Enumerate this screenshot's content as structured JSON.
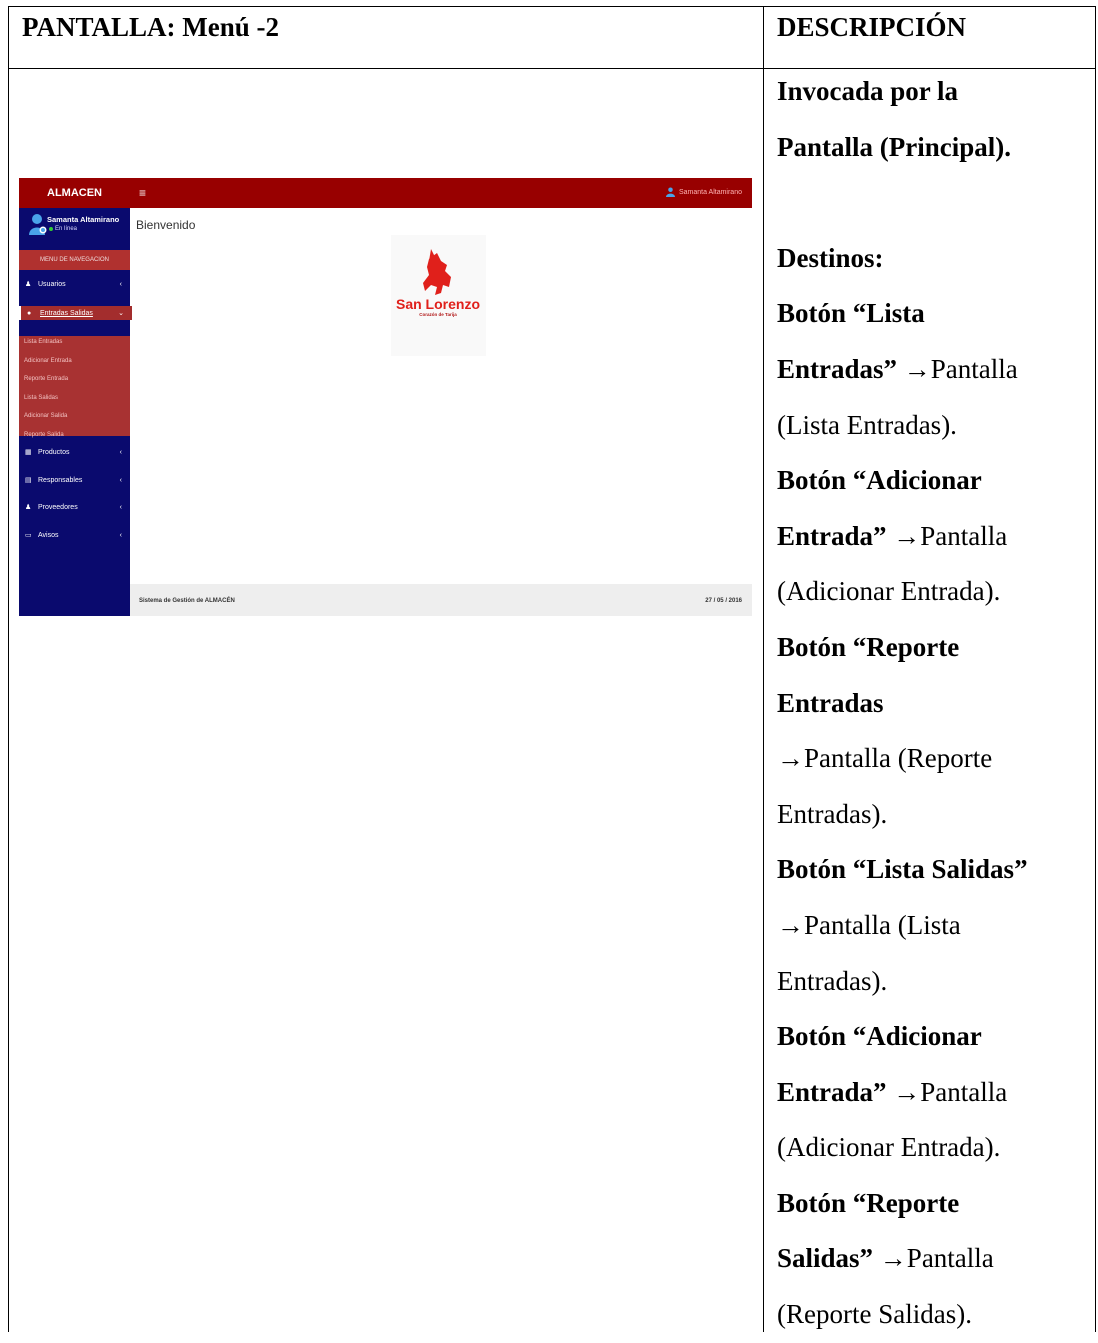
{
  "table": {
    "left_header": "PANTALLA: Menú -2",
    "right_header": "DESCRIPCIÓN"
  },
  "description": {
    "lines": [
      {
        "text": "Invocada por la",
        "bold": true
      },
      {
        "text": "Pantalla (Principal).",
        "bold": true
      },
      {
        "text": "",
        "bold": false
      },
      {
        "text": "Destinos:",
        "bold": true
      },
      {
        "parts": [
          {
            "text": "Botón “Lista",
            "bold": true
          }
        ]
      },
      {
        "parts": [
          {
            "text": "Entradas” ",
            "bold": true
          },
          {
            "text": "→Pantalla",
            "bold": false
          }
        ]
      },
      {
        "parts": [
          {
            "text": "(Lista Entradas).",
            "bold": false
          }
        ]
      },
      {
        "parts": [
          {
            "text": "Botón “Adicionar",
            "bold": true
          }
        ]
      },
      {
        "parts": [
          {
            "text": "Entrada” ",
            "bold": true
          },
          {
            "text": "→Pantalla",
            "bold": false
          }
        ]
      },
      {
        "parts": [
          {
            "text": "(Adicionar Entrada).",
            "bold": false
          }
        ]
      },
      {
        "parts": [
          {
            "text": "Botón “Reporte",
            "bold": true
          }
        ]
      },
      {
        "parts": [
          {
            "text": "Entradas",
            "bold": true
          }
        ]
      },
      {
        "parts": [
          {
            "text": "→Pantalla (Reporte",
            "bold": false
          }
        ]
      },
      {
        "parts": [
          {
            "text": "Entradas).",
            "bold": false
          }
        ]
      },
      {
        "parts": [
          {
            "text": "Botón “Lista Salidas”",
            "bold": true
          }
        ]
      },
      {
        "parts": [
          {
            "text": "→Pantalla (Lista",
            "bold": false
          }
        ]
      },
      {
        "parts": [
          {
            "text": "Entradas).",
            "bold": false
          }
        ]
      },
      {
        "parts": [
          {
            "text": "Botón “Adicionar",
            "bold": true
          }
        ]
      },
      {
        "parts": [
          {
            "text": "Entrada” ",
            "bold": true
          },
          {
            "text": "→Pantalla",
            "bold": false
          }
        ]
      },
      {
        "parts": [
          {
            "text": "(Adicionar Entrada).",
            "bold": false
          }
        ]
      },
      {
        "parts": [
          {
            "text": "Botón “Reporte",
            "bold": true
          }
        ]
      },
      {
        "parts": [
          {
            "text": "Salidas” ",
            "bold": true
          },
          {
            "text": "→Pantalla",
            "bold": false
          }
        ]
      },
      {
        "parts": [
          {
            "text": "(Reporte Salidas).",
            "bold": false
          }
        ]
      }
    ]
  },
  "app": {
    "brand": "ALMACEN",
    "menu_icon": "≡",
    "top_user": "Samanta Altamirano",
    "user_name": "Samanta Altamirano",
    "user_status": "En línea",
    "nav_header": "MENU DE NAVEGACION",
    "nav": [
      {
        "label": "Usuarios",
        "icon": "user-icon",
        "glyph": "♟",
        "active": false
      },
      {
        "label": "Entradas Salidas",
        "icon": "circle-icon",
        "glyph": "●",
        "active": true
      },
      {
        "label": "Productos",
        "icon": "table-icon",
        "glyph": "▦",
        "active": false
      },
      {
        "label": "Responsables",
        "icon": "card-icon",
        "glyph": "▤",
        "active": false
      },
      {
        "label": "Proveedores",
        "icon": "user-icon",
        "glyph": "♟",
        "active": false
      },
      {
        "label": "Avisos",
        "icon": "laptop-icon",
        "glyph": "▭",
        "active": false
      }
    ],
    "subitems": [
      "Lista Entradas",
      "Adicionar Entrada",
      "Reporte Entrada",
      "Lista Salidas",
      "Adicionar Salida",
      "Reporte Salida"
    ],
    "welcome": "Bienvenido",
    "logo_text": "San Lorenzo",
    "logo_subtext": "Corazón de Tarija",
    "footer_left": "Sistema de Gestión de ALMACÉN",
    "footer_right": "27 / 05 / 2016"
  },
  "colors": {
    "topbar": "#980000",
    "sidebar": "#0a0a6e",
    "active_nav": "#a32d2d",
    "logo_red": "#e0201b"
  }
}
